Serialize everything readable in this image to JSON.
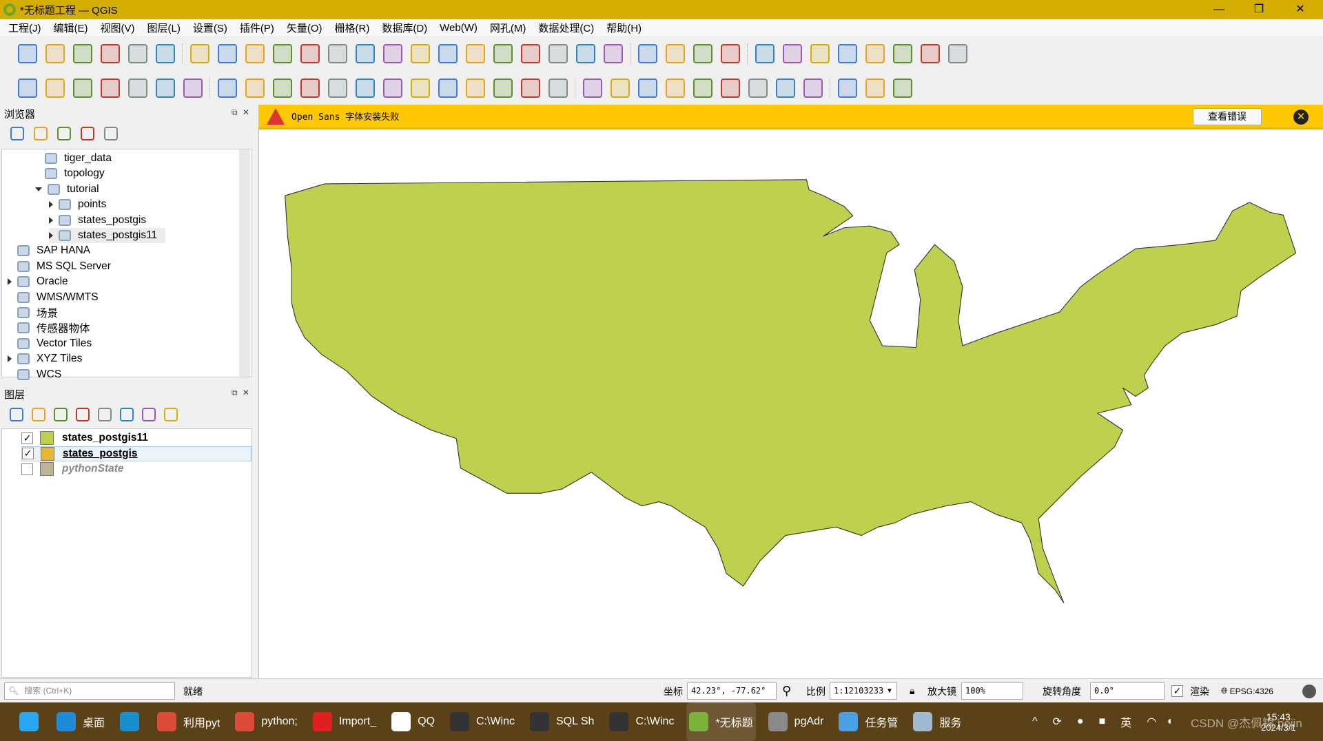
{
  "window": {
    "title": "*无标题工程 — QGIS",
    "min": "—",
    "max": "❐",
    "close": "✕"
  },
  "menu": [
    "工程(J)",
    "编辑(E)",
    "视图(V)",
    "图层(L)",
    "设置(S)",
    "插件(P)",
    "矢量(O)",
    "栅格(R)",
    "数据库(D)",
    "Web(W)",
    "网孔(M)",
    "数据处理(C)",
    "帮助(H)"
  ],
  "toolbar1": [
    "new-project-icon",
    "open-project-icon",
    "save-project-icon",
    "new-print-layout-icon",
    "layout-manager-icon",
    "style-manager-icon",
    "sep",
    "pan-icon",
    "pan-to-selection-icon",
    "zoom-in-icon",
    "zoom-out-icon",
    "zoom-full-icon",
    "zoom-to-selection-icon",
    "zoom-to-layer-icon",
    "zoom-native-icon",
    "zoom-last-icon",
    "zoom-next-icon",
    "new-map-view-icon",
    "new-3d-map-icon",
    "new-bookmark-icon",
    "show-bookmarks-icon",
    "temporal-controller-icon",
    "refresh-icon",
    "sep",
    "select-features-icon",
    "select-by-value-icon",
    "deselect-icon",
    "select-location-icon",
    "sep",
    "identify-icon",
    "attribute-table-icon",
    "processing-toolbox-icon",
    "statistics-icon",
    "open-table-icon",
    "measure-icon",
    "map-tips-icon",
    "locator-icon"
  ],
  "toolbar2": [
    "data-source-manager-icon",
    "new-geopackage-icon",
    "new-shapefile-icon",
    "digitize-icon",
    "new-spatialite-icon",
    "new-virtual-layer-icon",
    "new-temp-layer-icon",
    "sep",
    "current-edits-icon",
    "toggle-editing-icon",
    "save-edits-icon",
    "digitize-point-icon",
    "add-polygon-icon",
    "vertex-tool-icon",
    "modify-attributes-icon",
    "delete-selected-icon",
    "cut-icon",
    "copy-icon",
    "paste-icon",
    "undo-icon",
    "redo-icon",
    "sep",
    "label-toolbar-icon",
    "diagram-icon",
    "label-pin-icon",
    "label-show-icon",
    "label-move-icon",
    "label-rotate-icon",
    "label-change-icon",
    "label-edit-icon",
    "label-unpin-icon",
    "sep",
    "geoserver-icon",
    "python-console-icon",
    "help-icon"
  ],
  "messagebar": {
    "message": "Open Sans 字体安装失败",
    "view_errors": "查看错误",
    "close": "✕",
    "bg": "#ffc800"
  },
  "browser": {
    "title": "浏览器",
    "toolbar": [
      "add-selected-icon",
      "refresh-icon",
      "filter-icon",
      "collapse-all-icon",
      "properties-icon"
    ],
    "items": [
      {
        "label": "tiger_data",
        "icon": "schema-icon",
        "indent": 3,
        "expander": "none"
      },
      {
        "label": "topology",
        "icon": "schema-icon",
        "indent": 3,
        "expander": "none"
      },
      {
        "label": "tutorial",
        "icon": "schema-icon",
        "indent": 3,
        "expander": "expanded"
      },
      {
        "label": "points",
        "icon": "point-layer-icon",
        "indent": 4,
        "expander": "collapsed"
      },
      {
        "label": "states_postgis",
        "icon": "polygon-layer-icon",
        "indent": 4,
        "expander": "collapsed"
      },
      {
        "label": "states_postgis11",
        "icon": "polygon-layer-icon",
        "indent": 4,
        "expander": "collapsed",
        "selected": true
      },
      {
        "label": "SAP HANA",
        "icon": "sap-hana-icon",
        "indent": 1,
        "expander": "none"
      },
      {
        "label": "MS SQL Server",
        "icon": "mssql-icon",
        "indent": 1,
        "expander": "none"
      },
      {
        "label": "Oracle",
        "icon": "oracle-icon",
        "indent": 1,
        "expander": "collapsed"
      },
      {
        "label": "WMS/WMTS",
        "icon": "wms-icon",
        "indent": 1,
        "expander": "none"
      },
      {
        "label": "场景",
        "icon": "scene-icon",
        "indent": 1,
        "expander": "none"
      },
      {
        "label": "传感器物体",
        "icon": "sensor-icon",
        "indent": 1,
        "expander": "none"
      },
      {
        "label": "Vector Tiles",
        "icon": "vector-tiles-icon",
        "indent": 1,
        "expander": "none"
      },
      {
        "label": "XYZ Tiles",
        "icon": "xyz-tiles-icon",
        "indent": 1,
        "expander": "collapsed"
      },
      {
        "label": "WCS",
        "icon": "wcs-icon",
        "indent": 1,
        "expander": "none"
      }
    ]
  },
  "layers": {
    "title": "图层",
    "toolbar": [
      "style-panel-icon",
      "add-group-icon",
      "manage-visibility-icon",
      "filter-legend-icon",
      "filter-expression-icon",
      "expand-all-icon",
      "collapse-all-icon",
      "remove-layer-icon"
    ],
    "items": [
      {
        "label": "states_postgis11",
        "checked": true,
        "color": "#bfcf4e",
        "style": "bold"
      },
      {
        "label": "states_postgis",
        "checked": true,
        "color": "#e5b638",
        "style": "bold-underline",
        "selected": true
      },
      {
        "label": "pythonState",
        "checked": false,
        "color": "#bfb395",
        "style": "italic-gray"
      }
    ]
  },
  "map": {
    "fill": "#bfcf4e",
    "stroke": "#333333"
  },
  "statusbar": {
    "search_placeholder": "搜索 (Ctrl+K)",
    "ready": "就绪",
    "coord_label": "坐标",
    "coord_value": "42.23°, -77.62°",
    "scale_label": "比例",
    "scale_value": "1:12103233",
    "magnifier_label": "放大镜",
    "magnifier_value": "100%",
    "rotation_label": "旋转角度",
    "rotation_value": "0.0°",
    "render_label": "渲染",
    "render_checked": true,
    "crs": "EPSG:4326"
  },
  "taskbar": {
    "items": [
      {
        "label": "",
        "icon": "windows-start-icon",
        "color": "#2aa7f0"
      },
      {
        "label": "桌面",
        "icon": "file-explorer-icon",
        "color": "#1f8ad8"
      },
      {
        "label": "",
        "icon": "edge-icon",
        "color": "#1a8fd0"
      },
      {
        "label": "利用pyt",
        "icon": "chrome-icon",
        "color": "#dd4b39"
      },
      {
        "label": "python;",
        "icon": "chrome-icon",
        "color": "#dd4b39"
      },
      {
        "label": "Import_",
        "icon": "wps-icon",
        "color": "#e02020"
      },
      {
        "label": "QQ",
        "icon": "qq-icon",
        "color": "#ffffff"
      },
      {
        "label": "C:\\Winc",
        "icon": "terminal-icon",
        "color": "#333333"
      },
      {
        "label": "SQL Sh",
        "icon": "terminal-icon",
        "color": "#333333"
      },
      {
        "label": "C:\\Winc",
        "icon": "terminal-icon",
        "color": "#333333"
      },
      {
        "label": "*无标题",
        "icon": "qgis-icon",
        "color": "#7bb33a",
        "active": true
      },
      {
        "label": "pgAdr",
        "icon": "pgadmin-icon",
        "color": "#8a8a8a"
      },
      {
        "label": "任务管",
        "icon": "task-manager-icon",
        "color": "#4aa0e0"
      },
      {
        "label": "服务",
        "icon": "services-icon",
        "color": "#a0b8d0"
      }
    ],
    "tray": {
      "ime": "英",
      "time": "15:43",
      "date": "2024/3/1",
      "watermark": "CSDN @杰佩锦 pejin"
    }
  }
}
